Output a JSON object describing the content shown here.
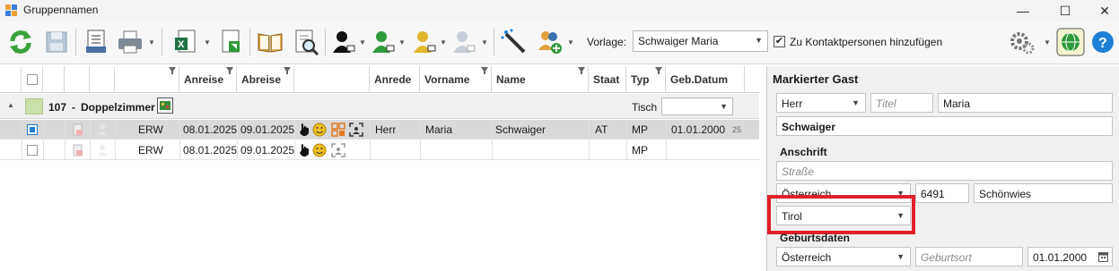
{
  "window": {
    "title": "Gruppennamen",
    "minimize": "—",
    "maximize": "☐",
    "close": "✕"
  },
  "toolbar": {
    "vorlage_label": "Vorlage:",
    "vorlage_value": "Schwaiger Maria",
    "kontakt_label": "Zu Kontaktpersonen hinzufügen",
    "kontakt_checked": "✔",
    "icons": [
      "refresh-icon",
      "save-icon",
      "list-print-icon",
      "printer-icon",
      "excel-export-icon",
      "export-icon",
      "book-icon",
      "search-document-icon",
      "user-black-icon",
      "user-green-icon",
      "user-yellow-icon",
      "user-grey-icon",
      "magic-wand-icon",
      "add-users-icon",
      "settings-gear-icon",
      "globe-icon",
      "help-icon"
    ]
  },
  "grid": {
    "columns": {
      "anreise": "Anreise",
      "abreise": "Abreise",
      "anrede": "Anrede",
      "vorname": "Vorname",
      "name": "Name",
      "staat": "Staat",
      "typ": "Typ",
      "gebdatum": "Geb.Datum"
    },
    "group": {
      "room": "107",
      "dash": "-",
      "type": "Doppelzimmer",
      "tisch_label": "Tisch"
    },
    "rows": [
      {
        "code": "ERW",
        "anreise": "08.01.2025",
        "abreise": "09.01.2025",
        "anrede": "Herr",
        "vorname": "Maria",
        "name": "Schwaiger",
        "staat": "AT",
        "typ": "MP",
        "gebdatum": "01.01.2000",
        "age": "25"
      },
      {
        "code": "ERW",
        "anreise": "08.01.2025",
        "abreise": "09.01.2025",
        "anrede": "",
        "vorname": "",
        "name": "",
        "staat": "",
        "typ": "MP",
        "gebdatum": "",
        "age": ""
      }
    ]
  },
  "panel": {
    "title": "Markierter Gast",
    "anrede_value": "Herr",
    "titel_placeholder": "Titel",
    "vorname_value": "Maria",
    "nachname_value": "Schwaiger",
    "anschrift_label": "Anschrift",
    "strasse_placeholder": "Straße",
    "land_value": "Österreich",
    "plz_value": "6491",
    "ort_value": "Schönwies",
    "bundesland_value": "Tirol",
    "geburtsdaten_label": "Geburtsdaten",
    "geburtsland_value": "Österreich",
    "geburtsort_placeholder": "Geburtsort",
    "geburtsdatum_value": "01.01.2000"
  },
  "colors": {
    "highlight": "#e0202a",
    "accent_blue": "#1e7fd6",
    "toolbar_green": "#2f9a3a"
  }
}
